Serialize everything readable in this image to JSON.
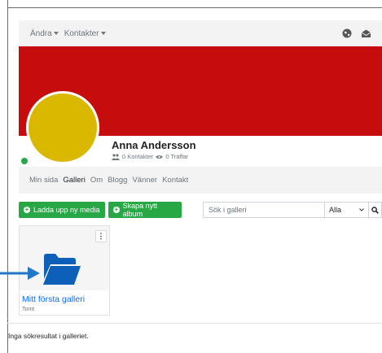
{
  "navbar": {
    "menus": [
      {
        "label": "Ändra"
      },
      {
        "label": "Kontakter"
      }
    ],
    "icons": [
      "globe-icon",
      "inbox-icon"
    ]
  },
  "profile": {
    "name": "Anna Andersson",
    "contacts": "0 Kontakter",
    "hits": "0 Träffar",
    "cover_color": "#c60c0c",
    "avatar_color": "#dbb800",
    "online": true
  },
  "tabs": [
    {
      "label": "Min sida",
      "active": false
    },
    {
      "label": "Galleri",
      "active": true
    },
    {
      "label": "Om",
      "active": false
    },
    {
      "label": "Blogg",
      "active": false
    },
    {
      "label": "Vänner",
      "active": false
    },
    {
      "label": "Kontakt",
      "active": false
    }
  ],
  "actions": {
    "upload_label": "Ladda upp ny media",
    "create_album_label": "Skapa nytt album"
  },
  "search": {
    "placeholder": "Sök i galleri",
    "scope_selected": "Alla"
  },
  "gallery": {
    "title": "Mitt första galleri",
    "subtitle": "Tomt"
  },
  "results": {
    "empty_message": "Inga sökresultat i galleriet."
  },
  "colors": {
    "accent": "#28a745",
    "link": "#0d6efd",
    "folder": "#0d5fb8"
  }
}
